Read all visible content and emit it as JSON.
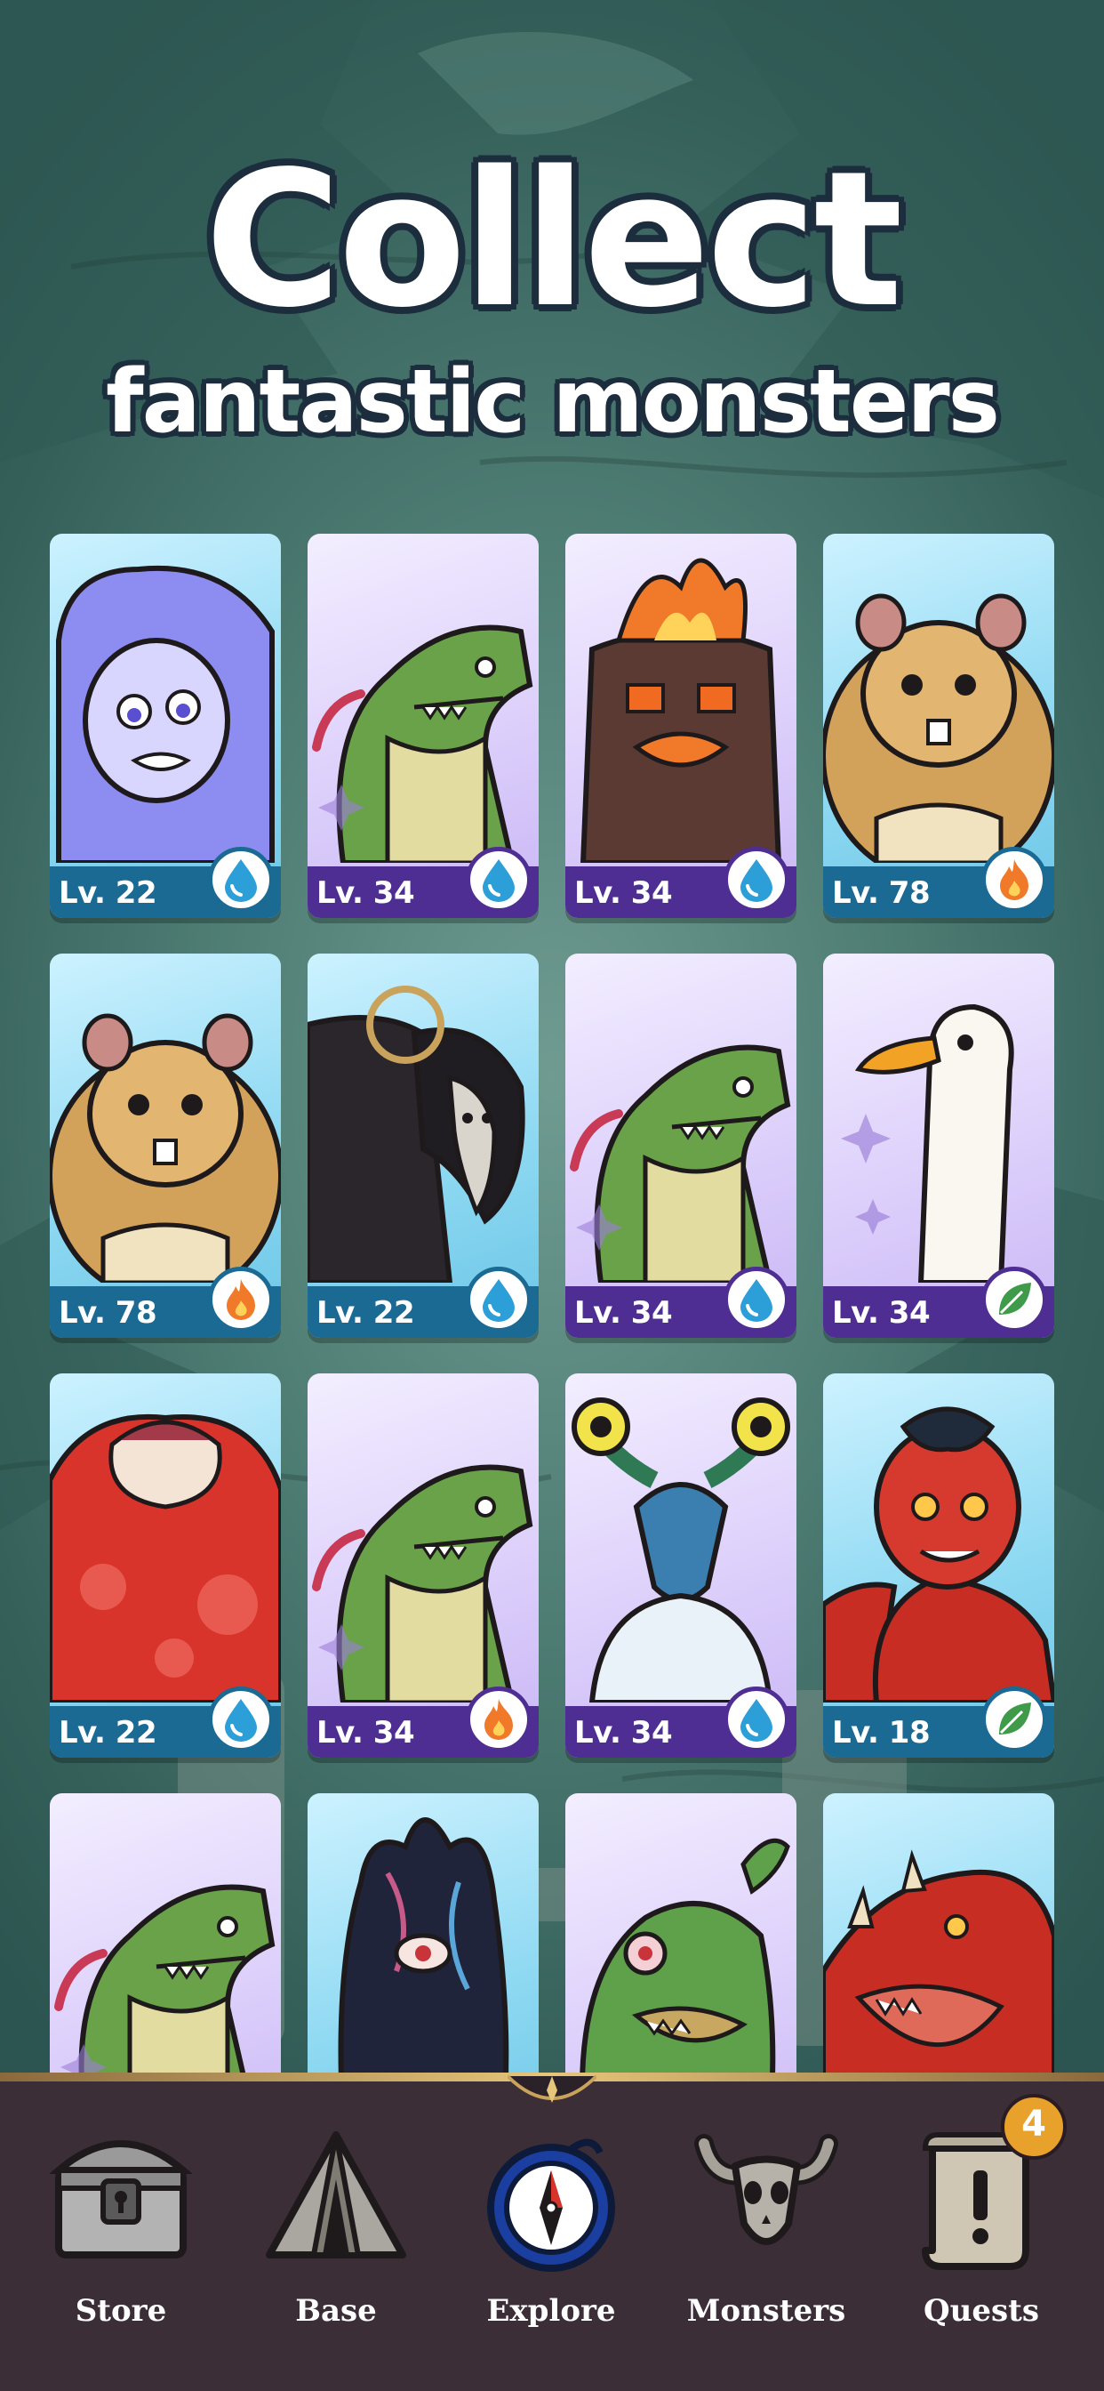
{
  "headline": {
    "title": "Collect",
    "subtitle": "fantastic monsters"
  },
  "cards": [
    {
      "level": "Lv. 22",
      "element": "water",
      "theme": "blue",
      "monster": "blue-ghost-girl"
    },
    {
      "level": "Lv. 34",
      "element": "water",
      "theme": "purple",
      "monster": "green-lizard"
    },
    {
      "level": "Lv. 34",
      "element": "water",
      "theme": "purple",
      "monster": "fire-stump"
    },
    {
      "level": "Lv. 78",
      "element": "fire",
      "theme": "blue",
      "monster": "hamster-brute"
    },
    {
      "level": "Lv. 78",
      "element": "fire",
      "theme": "blue",
      "monster": "hamster-brute"
    },
    {
      "level": "Lv. 22",
      "element": "water",
      "theme": "blue",
      "monster": "plague-crow"
    },
    {
      "level": "Lv. 34",
      "element": "water",
      "theme": "purple",
      "monster": "green-lizard"
    },
    {
      "level": "Lv. 34",
      "element": "leaf",
      "theme": "purple",
      "monster": "white-goose"
    },
    {
      "level": "Lv. 22",
      "element": "water",
      "theme": "blue",
      "monster": "red-blob"
    },
    {
      "level": "Lv. 34",
      "element": "fire",
      "theme": "purple",
      "monster": "green-lizard"
    },
    {
      "level": "Lv. 34",
      "element": "water",
      "theme": "purple",
      "monster": "antler-deer"
    },
    {
      "level": "Lv. 18",
      "element": "leaf",
      "theme": "blue",
      "monster": "red-imp"
    },
    {
      "level": "",
      "element": "",
      "theme": "purple",
      "monster": "green-lizard"
    },
    {
      "level": "",
      "element": "",
      "theme": "blue",
      "monster": "ink-eye"
    },
    {
      "level": "",
      "element": "",
      "theme": "purple",
      "monster": "swamp-goblin"
    },
    {
      "level": "",
      "element": "",
      "theme": "blue",
      "monster": "red-dragon"
    }
  ],
  "nav": {
    "items": [
      {
        "label": "Store",
        "icon": "treasure-chest-icon"
      },
      {
        "label": "Base",
        "icon": "tent-icon"
      },
      {
        "label": "Explore",
        "icon": "compass-icon"
      },
      {
        "label": "Monsters",
        "icon": "horned-skull-icon"
      },
      {
        "label": "Quests",
        "icon": "scroll-icon",
        "badge": "4"
      }
    ]
  },
  "colors": {
    "water": "#2c9fd8",
    "fire": "#f07a2a",
    "leaf": "#3f9a4a",
    "nav_bg": "#3b2e36",
    "badge": "#e8a12a"
  }
}
